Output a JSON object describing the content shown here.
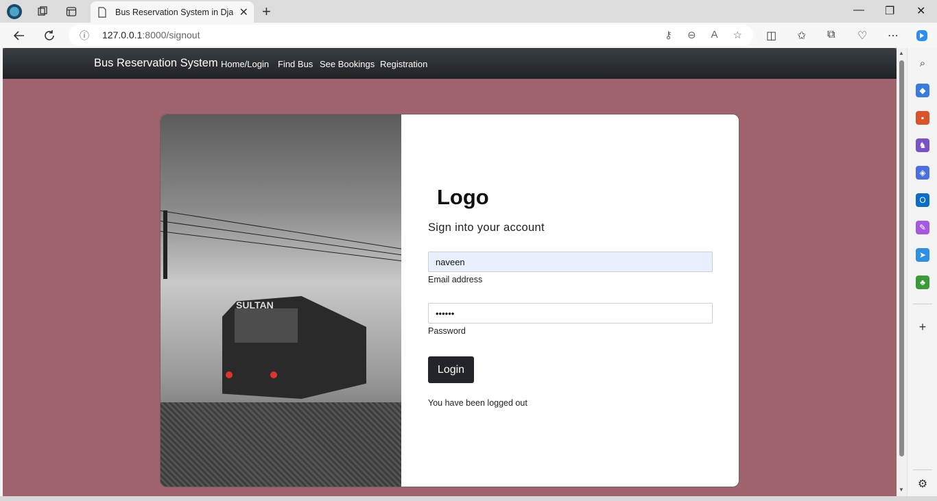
{
  "browser": {
    "tab_title": "Bus Reservation System in Djang",
    "url_host": "127.0.0.1",
    "url_path": ":8000/signout",
    "new_tab_glyph": "+",
    "tab_close_glyph": "✕"
  },
  "navbar": {
    "brand": "Bus Reservation System",
    "links": [
      "Home/Login",
      "Find Bus",
      "See Bookings",
      "Registration"
    ]
  },
  "login": {
    "logo": "Logo",
    "subtitle": "Sign into your account",
    "email_value": "naveen",
    "email_label": "Email address",
    "password_value": "••••••",
    "password_label": "Password",
    "button_label": "Login",
    "status_message": "You have been logged out"
  },
  "photo": {
    "bus_sign": "SULTAN",
    "icon": "bus-photo"
  },
  "colors": {
    "page_bg": "#9e636c",
    "navbar_bg": "#1f2326",
    "button_bg": "#222529",
    "email_field_bg": "#e8f0fe"
  }
}
